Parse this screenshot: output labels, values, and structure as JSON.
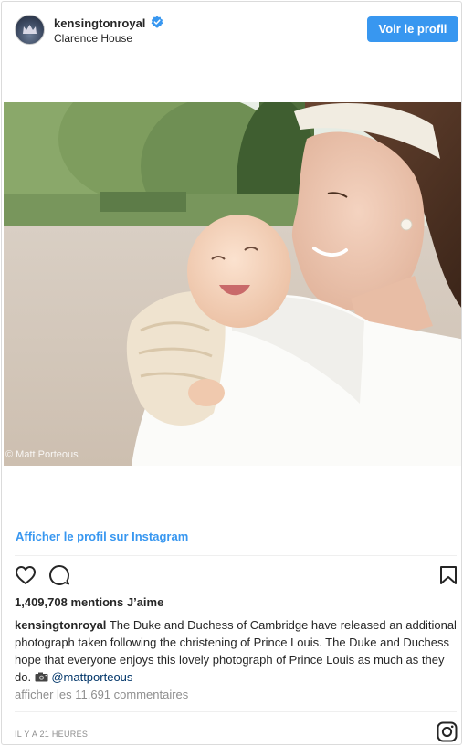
{
  "header": {
    "username": "kensingtonroyal",
    "location": "Clarence House",
    "profile_button": "Voir le profil"
  },
  "photo": {
    "watermark": "© Matt Porteous"
  },
  "view_profile_link": "Afficher le profil sur Instagram",
  "actions": {
    "like_icon": "heart-icon",
    "comment_icon": "comment-icon",
    "save_icon": "bookmark-icon"
  },
  "likes": "1,409,708 mentions J’aime",
  "caption": {
    "username": "kensingtonroyal",
    "text": "The Duke and Duchess of Cambridge have released an additional photograph taken following the christening of Prince Louis. The Duke and Duchess hope that everyone enjoys this lovely photograph of Prince Louis as much as they do.",
    "camera_icon": "camera-icon",
    "mention": "@mattporteous"
  },
  "comments_link": "afficher les 11,691 commentaires",
  "timestamp": "IL Y A 21 HEURES",
  "footer": {
    "instagram_icon": "instagram-logo-icon"
  },
  "colors": {
    "accent": "#3897f0",
    "text": "#262626",
    "muted": "#8e8e8e",
    "border": "#dbdbdb"
  }
}
